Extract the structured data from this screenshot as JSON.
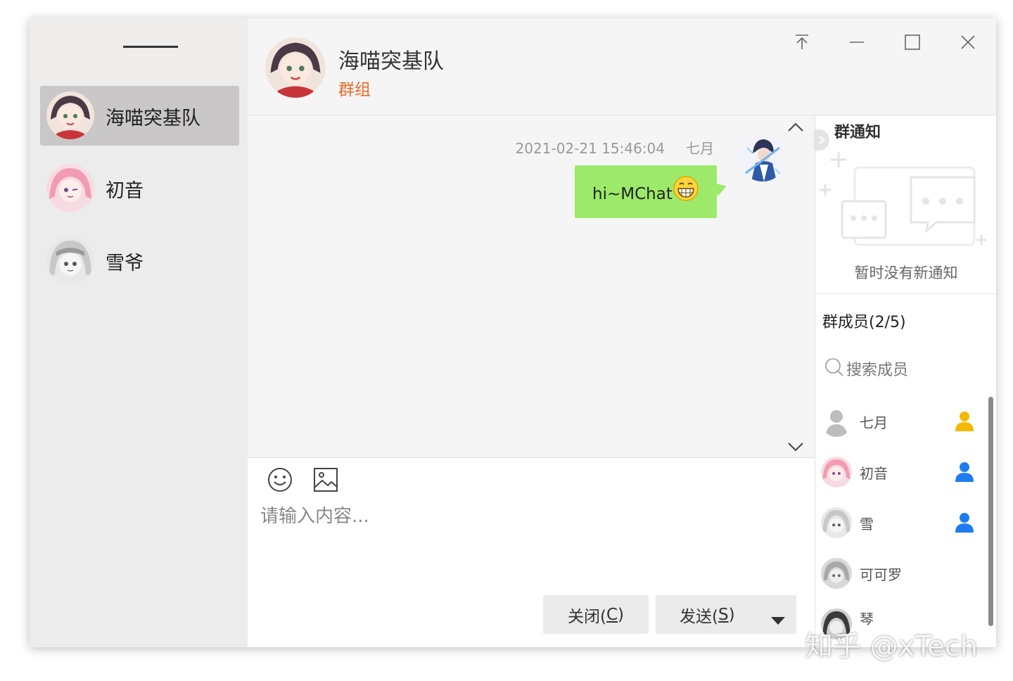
{
  "sidebar": {
    "contacts": [
      {
        "name": "海喵突基队",
        "active": true
      },
      {
        "name": "初音",
        "active": false
      },
      {
        "name": "雪爷",
        "active": false
      }
    ]
  },
  "header": {
    "title": "海喵突基队",
    "subtitle": "群组"
  },
  "messages": [
    {
      "time": "2021-02-21 15:46:04",
      "sender": "七月",
      "text": "hi~MChat",
      "emoji": "grinning-emoji"
    }
  ],
  "input": {
    "placeholder": "请输入内容...",
    "close_label": "关闭(C)",
    "send_label": "发送(S)",
    "close_text": "关闭(",
    "close_key": "C",
    "send_text": "发送(",
    "send_key": "S",
    "paren_close": ")"
  },
  "notice": {
    "title": "群通知",
    "empty_text": "暂时没有新通知"
  },
  "members": {
    "title": "群成员(2/5)",
    "search_placeholder": "搜索成员",
    "list": [
      {
        "name": "七月",
        "role_color": "#f5b800"
      },
      {
        "name": "初音",
        "role_color": "#1f7cf0"
      },
      {
        "name": "雪",
        "role_color": "#1f7cf0"
      },
      {
        "name": "可可罗",
        "role_color": ""
      },
      {
        "name": "琴",
        "role_color": ""
      }
    ]
  },
  "watermark": "知乎 @xTech",
  "colors": {
    "accent_orange": "#ee6a2b",
    "bubble_green": "#9dea6a",
    "owner_yellow": "#f5b800",
    "member_blue": "#1f7cf0"
  }
}
